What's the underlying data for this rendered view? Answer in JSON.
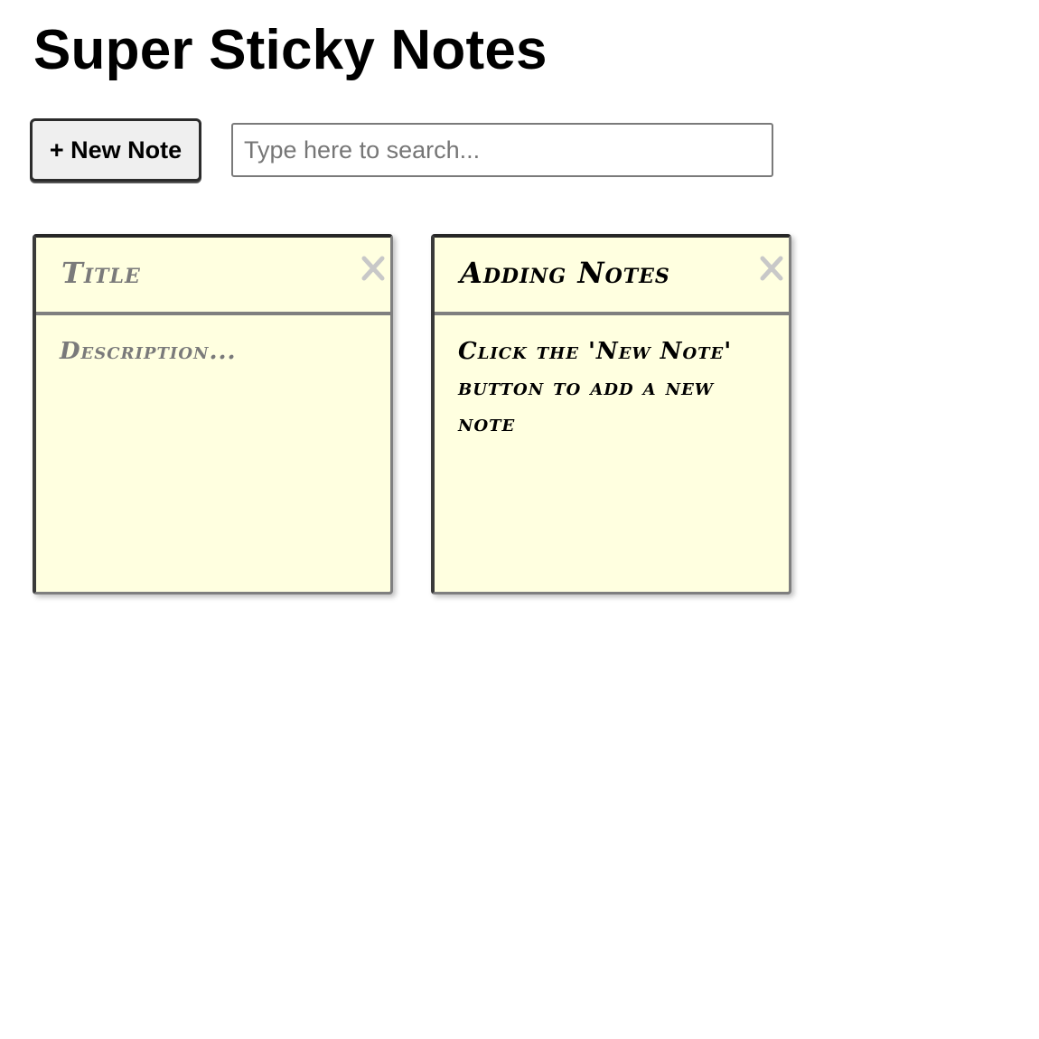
{
  "app": {
    "title": "Super Sticky Notes"
  },
  "toolbar": {
    "new_note_label": "+ New Note",
    "search_placeholder": "Type here to search...",
    "search_value": ""
  },
  "notes": [
    {
      "title_placeholder": "Title",
      "description_placeholder": "Description...",
      "title": "",
      "description": ""
    },
    {
      "title": "Adding Notes",
      "description": "Click the 'New Note' button to add a new note"
    }
  ],
  "icons": {
    "close": "close-icon"
  },
  "colors": {
    "note_background": "#ffffe0",
    "note_border": "#7f7f7f",
    "close_icon": "#c8c8c8",
    "placeholder_text": "#7a7a7a"
  }
}
